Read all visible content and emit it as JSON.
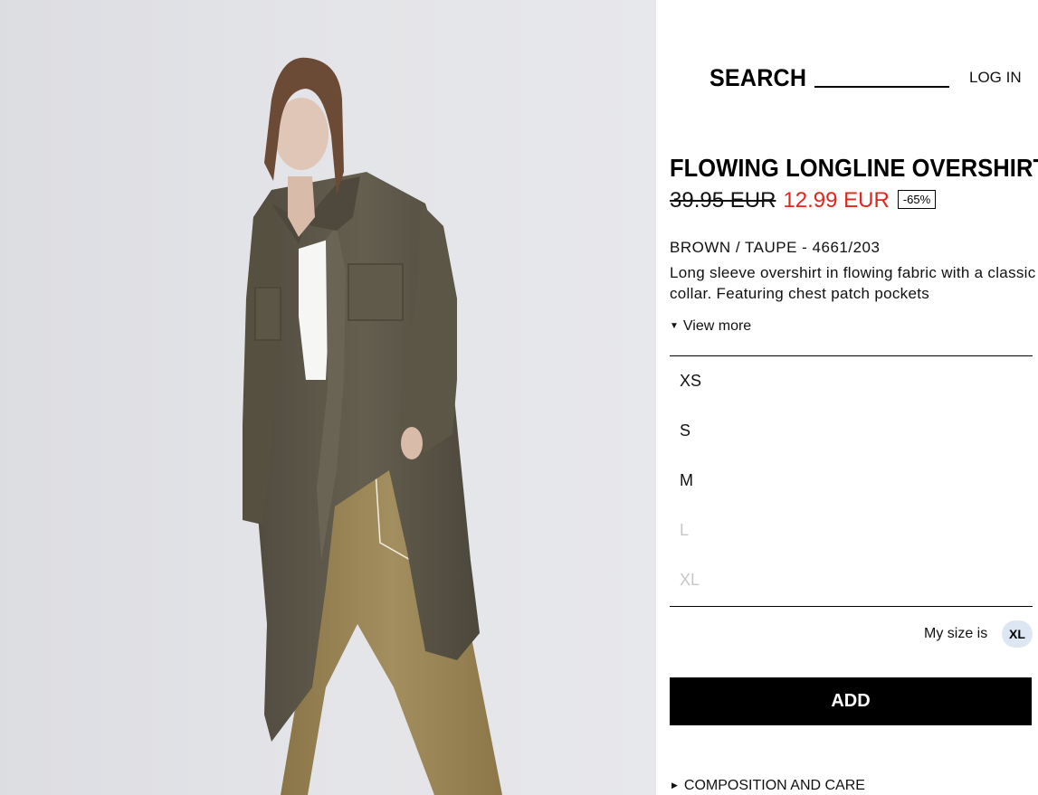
{
  "product_image": {
    "description_icon": "model-photo",
    "colors": {
      "background": "#e3e4e8",
      "shirt": "#5f5a4c",
      "trousers": "#9a8556",
      "top": "#ffffff",
      "skin": "#dcc0ae",
      "hair": "#6b4a36"
    }
  },
  "header": {
    "search_label": "SEARCH",
    "login_label": "LOG IN"
  },
  "product": {
    "title": "FLOWING LONGLINE OVERSHIRT",
    "old_price": "39.95 EUR",
    "new_price": "12.99 EUR",
    "discount": "-65%",
    "color_ref": "BROWN / TAUPE - 4661/203",
    "description": "Long sleeve overshirt in flowing fabric with a classic collar. Featuring chest patch pockets",
    "view_more": "View more"
  },
  "sizes": [
    {
      "label": "XS",
      "available": true
    },
    {
      "label": "S",
      "available": true
    },
    {
      "label": "M",
      "available": true
    },
    {
      "label": "L",
      "available": false
    },
    {
      "label": "XL",
      "available": false
    }
  ],
  "my_size": {
    "label": "My size is",
    "value": "XL"
  },
  "actions": {
    "add_label": "ADD",
    "composition_label": "COMPOSITION AND CARE"
  },
  "colors": {
    "sale_red": "#e4241a",
    "unavailable_gray": "#c7c7c7",
    "badge_blue": "#dce7f3",
    "button_black": "#000000"
  }
}
